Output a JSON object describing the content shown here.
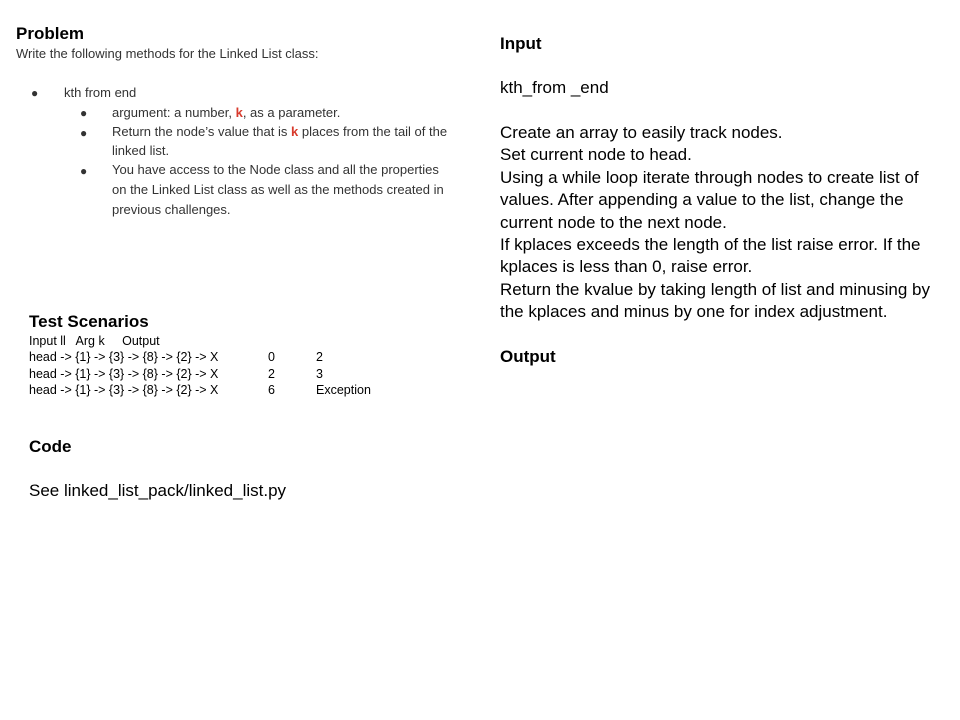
{
  "problem": {
    "title": "Problem",
    "subtitle": "Write the following methods for the Linked List class:",
    "bullet_main": "kth from end",
    "arg_pre": "argument: a number, ",
    "arg_k": "k",
    "arg_post": ", as a parameter.",
    "return_pre": "Return the node’s value that is ",
    "return_k": "k",
    "return_post": " places from the tail of the",
    "return_line2": "linked list.",
    "access_line1": "You have access to the Node class and all the properties",
    "access_line2": "on the Linked List class as well as the methods created in",
    "access_line3": "previous challenges."
  },
  "tests": {
    "title": "Test Scenarios",
    "header": "Input ll   Arg k     Output",
    "rows": [
      {
        "input": "head -> {1} -> {3} -> {8} -> {2} -> X",
        "k": "0",
        "output": "2"
      },
      {
        "input": "head -> {1} -> {3} -> {8} -> {2} -> X",
        "k": "2",
        "output": "3"
      },
      {
        "input": "head -> {1} -> {3} -> {8} -> {2} -> X",
        "k": "6",
        "output": "Exception"
      }
    ]
  },
  "code": {
    "title": "Code",
    "text": "See linked_list_pack/linked_list.py"
  },
  "input": {
    "title": "Input",
    "method": "kth_from _end",
    "lines": [
      "Create an array to easily track nodes.",
      "Set current node to head.",
      "Using a while loop iterate through nodes to create list of values. After appending a value to the list, change the current node to the next node.",
      "If kplaces exceeds the length of the list raise error. If the kplaces is less than 0, raise error.",
      "Return the kvalue by taking length of list and minusing by the kplaces and minus by one for index adjustment."
    ]
  },
  "output": {
    "title": "Output"
  }
}
